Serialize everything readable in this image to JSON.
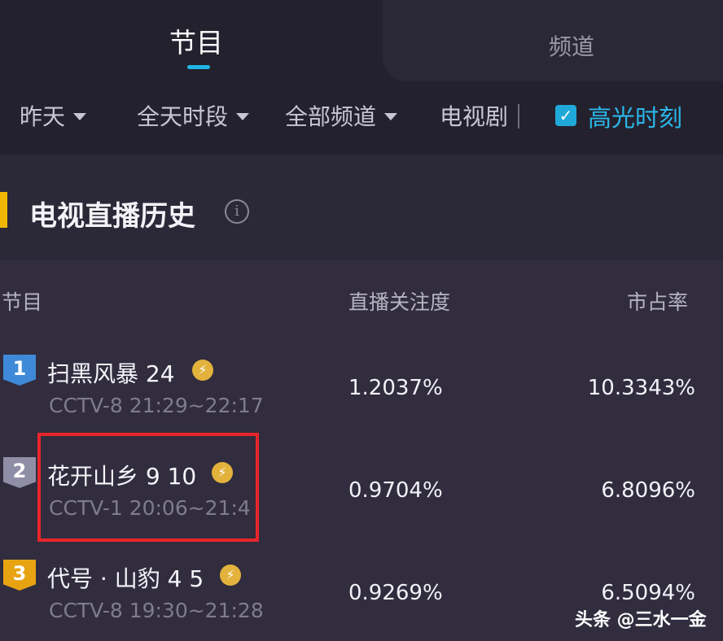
{
  "tabs": [
    {
      "label": "节目",
      "active": true
    },
    {
      "label": "频道",
      "active": false
    }
  ],
  "filters": {
    "day": "昨天",
    "period": "全天时段",
    "channel": "全部频道",
    "genre": "电视剧",
    "highlight_label": "高光时刻",
    "highlight_checked": true
  },
  "section": {
    "title": "电视直播历史"
  },
  "table": {
    "headers": {
      "program": "节目",
      "attention": "直播关注度",
      "share": "市占率"
    },
    "rows": [
      {
        "rank": "1",
        "name": "扫黑风暴 24",
        "time": "CCTV-8 21:29~22:17",
        "attention": "1.2037%",
        "share": "10.3343%"
      },
      {
        "rank": "2",
        "name": "花开山乡 9 10",
        "time": "CCTV-1 20:06~21:4",
        "attention": "0.9704%",
        "share": "6.8096%"
      },
      {
        "rank": "3",
        "name": "代号 · 山豹 4 5",
        "time": "CCTV-8 19:30~21:28",
        "attention": "0.9269%",
        "share": "6.5094%"
      }
    ]
  },
  "watermark": "头条 @三水一金",
  "colors": {
    "accent": "#1fb6e4",
    "highlight_box": "#e8252a",
    "section_bar": "#f2b705"
  }
}
